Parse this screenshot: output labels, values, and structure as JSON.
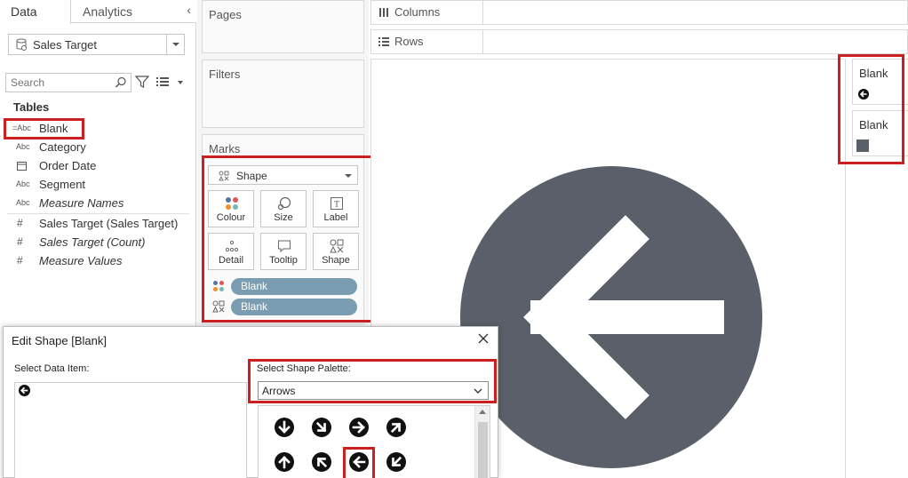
{
  "tabs": {
    "data": "Data",
    "analytics": "Analytics"
  },
  "datasource": {
    "name": "Sales Target"
  },
  "search": {
    "placeholder": "Search"
  },
  "tables": {
    "title": "Tables",
    "fields": [
      {
        "icon": "=Abc",
        "name": "Blank",
        "italic": false
      },
      {
        "icon": "Abc",
        "name": "Category",
        "italic": false
      },
      {
        "icon": "calendar-icon",
        "name": "Order Date",
        "italic": false
      },
      {
        "icon": "Abc",
        "name": "Segment",
        "italic": false
      },
      {
        "icon": "Abc",
        "name": "Measure Names",
        "italic": true
      },
      {
        "icon": "#",
        "name": "Sales Target (Sales Target)",
        "italic": false
      },
      {
        "icon": "#",
        "name": "Sales Target (Count)",
        "italic": true
      },
      {
        "icon": "#",
        "name": "Measure Values",
        "italic": true
      }
    ]
  },
  "shelves": {
    "pages": "Pages",
    "filters": "Filters",
    "marks": "Marks",
    "columns": "Columns",
    "rows": "Rows"
  },
  "marks": {
    "type": "Shape",
    "buttons": {
      "colour": "Colour",
      "size": "Size",
      "label": "Label",
      "detail": "Detail",
      "tooltip": "Tooltip",
      "shape": "Shape"
    },
    "pills": [
      "Blank",
      "Blank"
    ]
  },
  "legends": [
    {
      "title": "Blank",
      "swatch": "arrow-left-icon"
    },
    {
      "title": "Blank",
      "swatch": "gray-square"
    }
  ],
  "dialog": {
    "title": "Edit Shape [Blank]",
    "select_data_item": "Select Data Item:",
    "select_shape_palette": "Select Shape Palette:",
    "palette": "Arrows",
    "shapes": [
      "arrow-down",
      "arrow-down-right",
      "arrow-right",
      "arrow-up-right",
      "arrow-up",
      "arrow-up-left",
      "arrow-left",
      "arrow-down-left"
    ]
  },
  "colors": {
    "highlight": "#cc1f1f",
    "pill": "#7a9db2",
    "shape": "#5b5f69"
  }
}
